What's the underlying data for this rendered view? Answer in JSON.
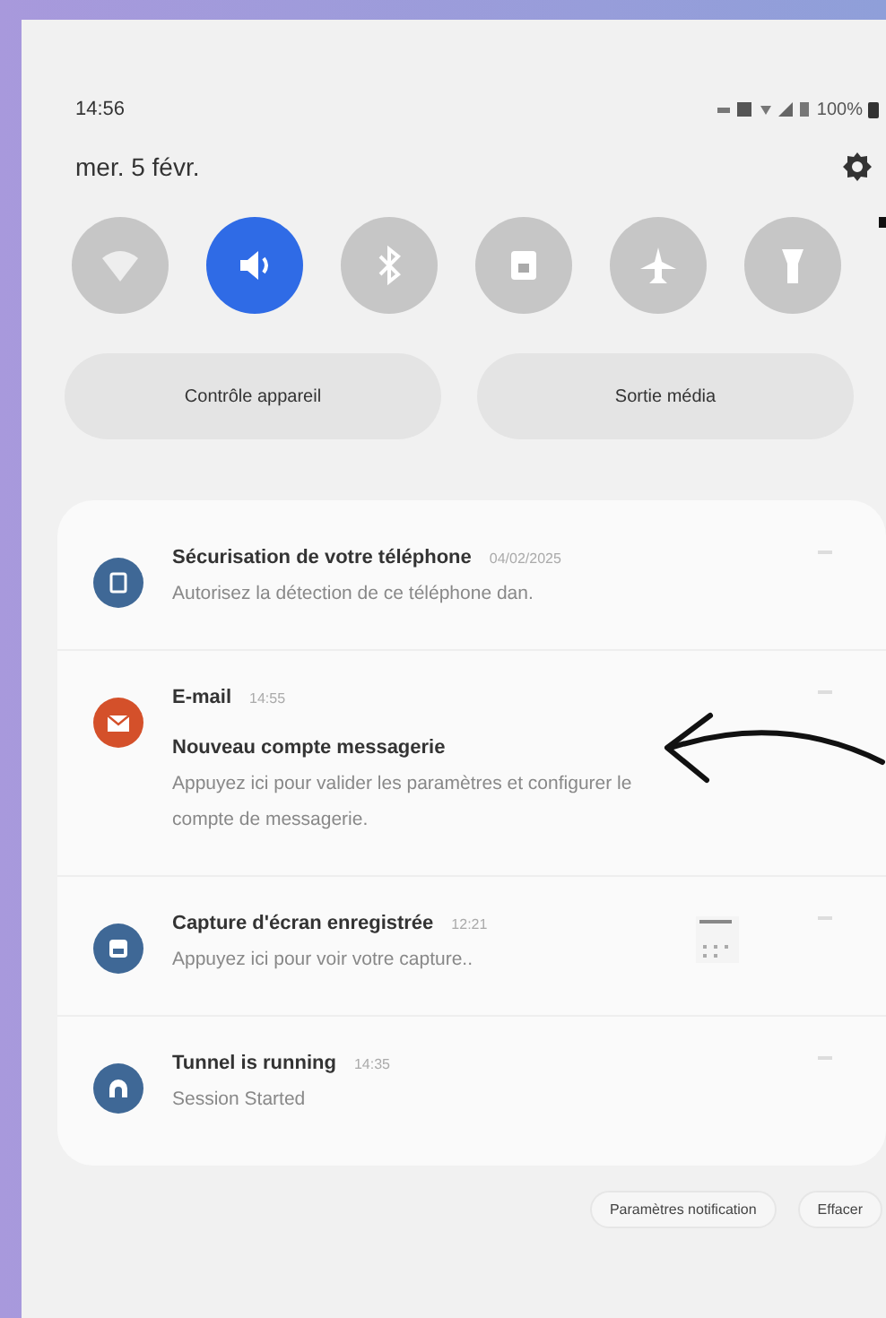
{
  "status_bar": {
    "time": "14:56",
    "battery": "100%"
  },
  "date": "mer. 5 févr.",
  "quick_tiles": [
    {
      "kind": "wifi",
      "on": false
    },
    {
      "kind": "sound",
      "on": true
    },
    {
      "kind": "bluetooth",
      "on": false
    },
    {
      "kind": "rotation",
      "on": false
    },
    {
      "kind": "airplane",
      "on": false
    },
    {
      "kind": "flashlight",
      "on": false
    }
  ],
  "panel_buttons": [
    "Contrôle appareil",
    "Sortie média"
  ],
  "notifications": [
    {
      "kind": "security",
      "color": "#3f6896",
      "app": "Sécurisation de votre téléphone",
      "time": "04/02/2025",
      "body": "Autorisez la détection de ce téléphone dan."
    },
    {
      "kind": "mail",
      "color": "#d4502a",
      "app": "E-mail",
      "time": "14:55",
      "title": "Nouveau compte messagerie",
      "body": "Appuyez ici pour valider les paramètres et configurer le compte de messagerie."
    },
    {
      "kind": "screenshot",
      "color": "#3f6896",
      "app": "Capture d'écran enregistrée",
      "time": "12:21",
      "body": "Appuyez ici pour voir votre capture.."
    },
    {
      "kind": "tunnel",
      "color": "#3f6896",
      "app": "Tunnel is running",
      "time": "14:35",
      "body": "Session Started"
    }
  ],
  "footer_buttons": [
    "Paramètres notification",
    "Effacer"
  ]
}
